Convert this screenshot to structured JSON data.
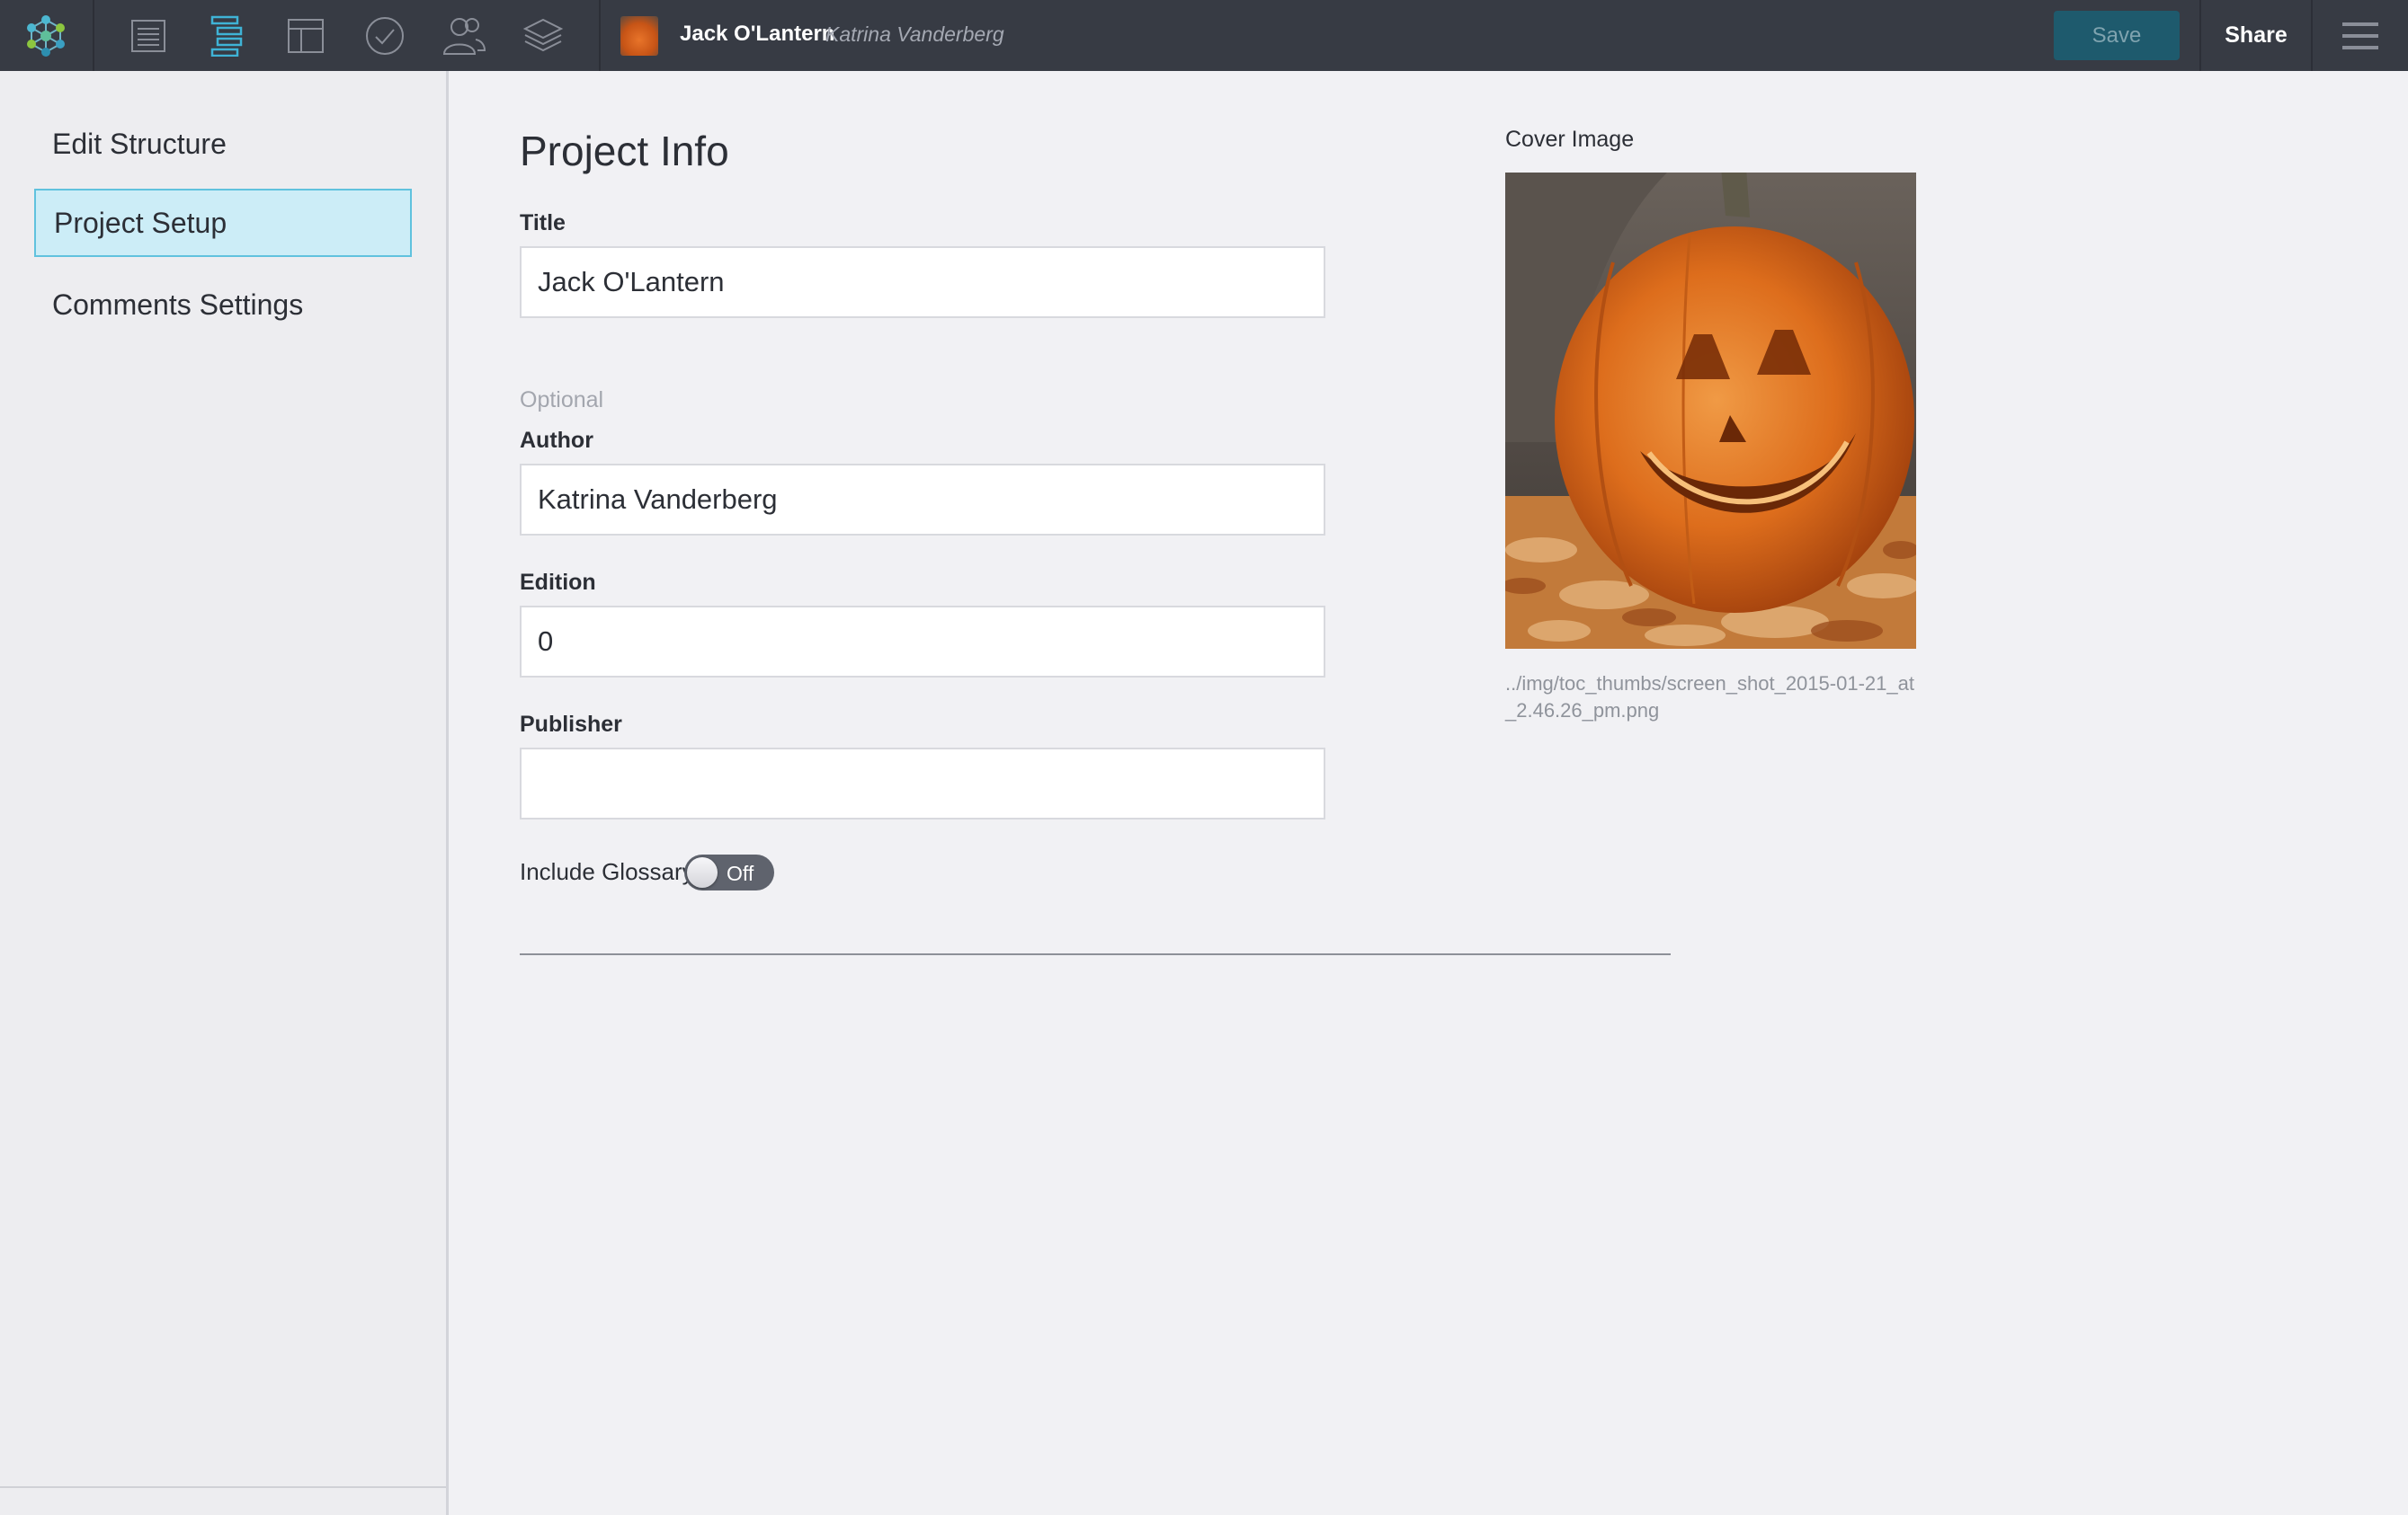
{
  "topbar": {
    "logo_icon": "network-logo-icon",
    "nav_icons": [
      "document-icon",
      "structure-icon",
      "layout-icon",
      "check-icon",
      "users-icon",
      "layers-icon"
    ],
    "active_nav": "structure-icon",
    "project_title": "Jack O'Lantern",
    "project_author": "Katrina Vanderberg",
    "save_label": "Save",
    "share_label": "Share",
    "menu_icon": "hamburger-menu-icon"
  },
  "sidebar": {
    "items": [
      {
        "label": "Edit Structure",
        "active": false
      },
      {
        "label": "Project Setup",
        "active": true
      },
      {
        "label": "Comments Settings",
        "active": false
      }
    ]
  },
  "main": {
    "title": "Project Info",
    "fields": {
      "title": {
        "label": "Title",
        "value": "Jack O'Lantern"
      },
      "optional_label": "Optional",
      "author": {
        "label": "Author",
        "value": "Katrina Vanderberg"
      },
      "edition": {
        "label": "Edition",
        "value": "0"
      },
      "publisher": {
        "label": "Publisher",
        "value": ""
      }
    },
    "glossary": {
      "label": "Include Glossary",
      "state": "Off"
    },
    "cover": {
      "label": "Cover Image",
      "path": "../img/toc_thumbs/screen_shot_2015-01-21_at_2.46.26_pm.png"
    }
  },
  "colors": {
    "topbar_bg": "#373b44",
    "accent": "#3fb3d6",
    "save_bg": "#1e5a6d",
    "active_item_bg": "#ccedf7"
  }
}
